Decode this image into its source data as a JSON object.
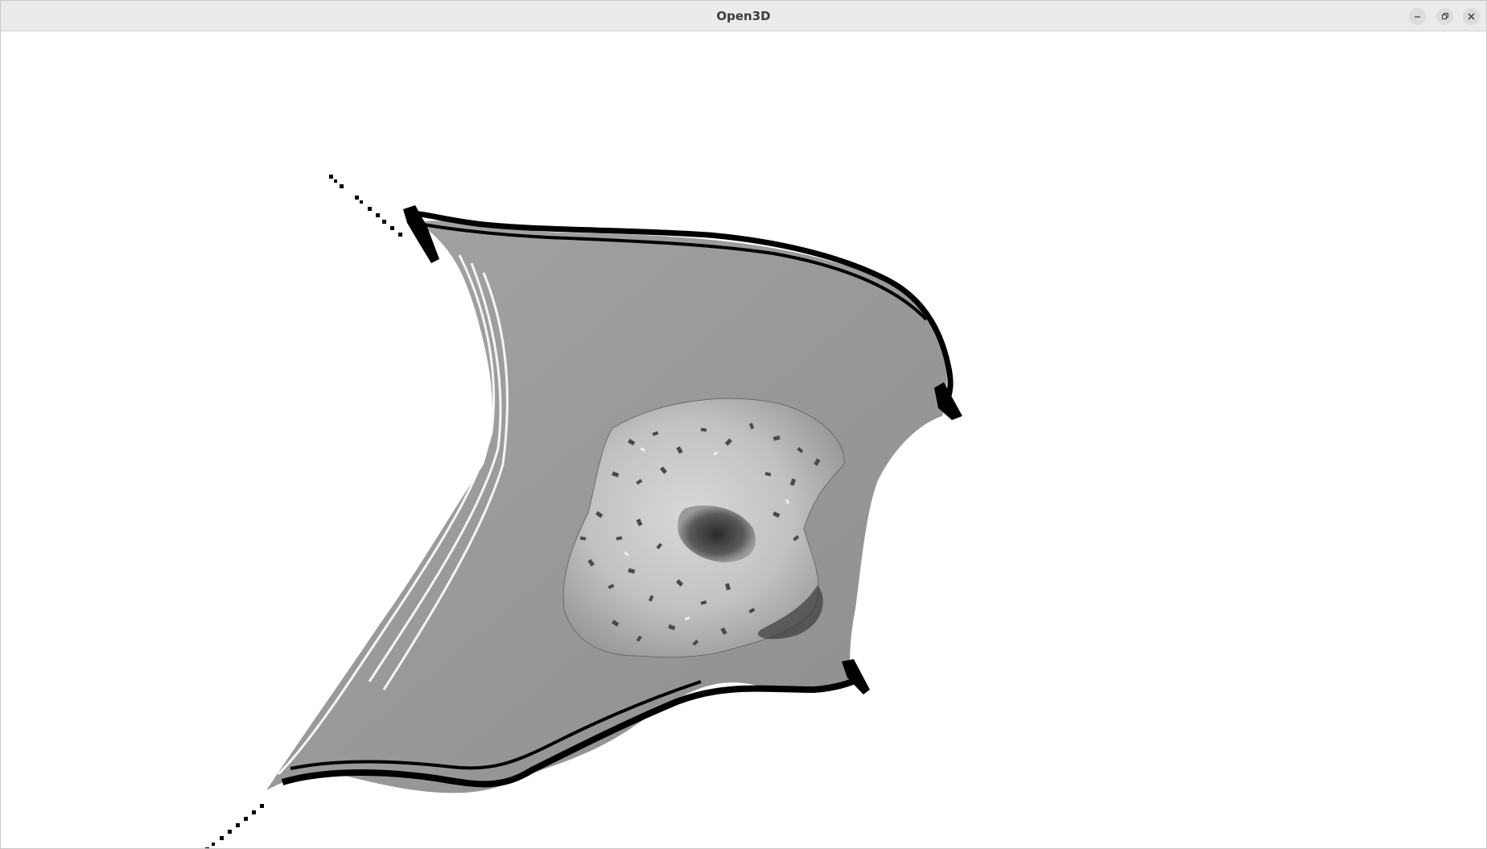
{
  "window": {
    "title": "Open3D",
    "controls": [
      {
        "name": "minimize-button",
        "icon": "minimize-icon"
      },
      {
        "name": "maximize-button",
        "icon": "maximize-icon"
      },
      {
        "name": "close-button",
        "icon": "close-icon"
      }
    ]
  },
  "viewport": {
    "background": "#ffffff",
    "content": "point-cloud-render",
    "render_mode": "grayscale"
  }
}
